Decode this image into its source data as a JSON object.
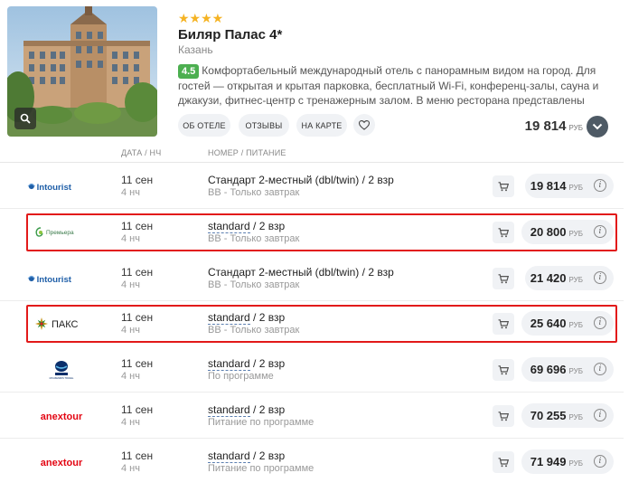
{
  "hotel": {
    "stars": "★★★★",
    "name": "Биляр Палас 4*",
    "city": "Казань",
    "rating": "4.5",
    "description": "Комфортабельный международный отель с панорамным видом на город. Для гостей — открытая и крытая парковка, бесплатный Wi-Fi, конференц-залы, сауна и джакузи, фитнес-центр с тренажерным залом. В меню ресторана представлены блюда русской, европейско...",
    "buttons": {
      "about": "ОБ ОТЕЛЕ",
      "reviews": "ОТЗЫВЫ",
      "map": "НА КАРТЕ"
    },
    "min_price": "19 814",
    "currency": "РУБ"
  },
  "table": {
    "headers": {
      "date": "ДАТА / НЧ",
      "room": "НОМЕР / ПИТАНИЕ"
    },
    "rows": [
      {
        "operator": "Intourist",
        "date": "11 сен",
        "nights": "4 нч",
        "room_type": "Стандарт 2-местный (dbl/twin)",
        "room_occ": " / 2 взр",
        "room_link": false,
        "meal": "BB - Только завтрак",
        "price": "19 814",
        "currency": "РУБ",
        "highlighted": false
      },
      {
        "operator": "Премьера",
        "date": "11 сен",
        "nights": "4 нч",
        "room_type": "standard",
        "room_occ": " / 2 взр",
        "room_link": true,
        "meal": "BB - Только завтрак",
        "price": "20 800",
        "currency": "РУБ",
        "highlighted": true
      },
      {
        "operator": "Intourist",
        "date": "11 сен",
        "nights": "4 нч",
        "room_type": "Стандарт 2-местный (dbl/twin)",
        "room_occ": " / 2 взр",
        "room_link": false,
        "meal": "BB - Только завтрак",
        "price": "21 420",
        "currency": "РУБ",
        "highlighted": false
      },
      {
        "operator": "ПАКС",
        "date": "11 сен",
        "nights": "4 нч",
        "room_type": "standard",
        "room_occ": " / 2 взр",
        "room_link": true,
        "meal": "BB - Только завтрак",
        "price": "25 640",
        "currency": "РУБ",
        "highlighted": true
      },
      {
        "operator": "MOUZENIDIS TRAVEL",
        "date": "11 сен",
        "nights": "4 нч",
        "room_type": "standard",
        "room_occ": " / 2 взр",
        "room_link": true,
        "meal": "По программе",
        "price": "69 696",
        "currency": "РУБ",
        "highlighted": false
      },
      {
        "operator": "anextour",
        "date": "11 сен",
        "nights": "4 нч",
        "room_type": "standard",
        "room_occ": " / 2 взр",
        "room_link": true,
        "meal": "Питание по программе",
        "price": "70 255",
        "currency": "РУБ",
        "highlighted": false
      },
      {
        "operator": "anextour",
        "date": "11 сен",
        "nights": "4 нч",
        "room_type": "standard",
        "room_occ": " / 2 взр",
        "room_link": true,
        "meal": "Питание по программе",
        "price": "71 949",
        "currency": "РУБ",
        "highlighted": false
      }
    ]
  },
  "colors": {
    "highlight": "#e21a1a",
    "rating_badge": "#4caf50",
    "star": "#f5b323",
    "anex_red": "#e30613",
    "intourist_blue": "#1f5fa8"
  }
}
